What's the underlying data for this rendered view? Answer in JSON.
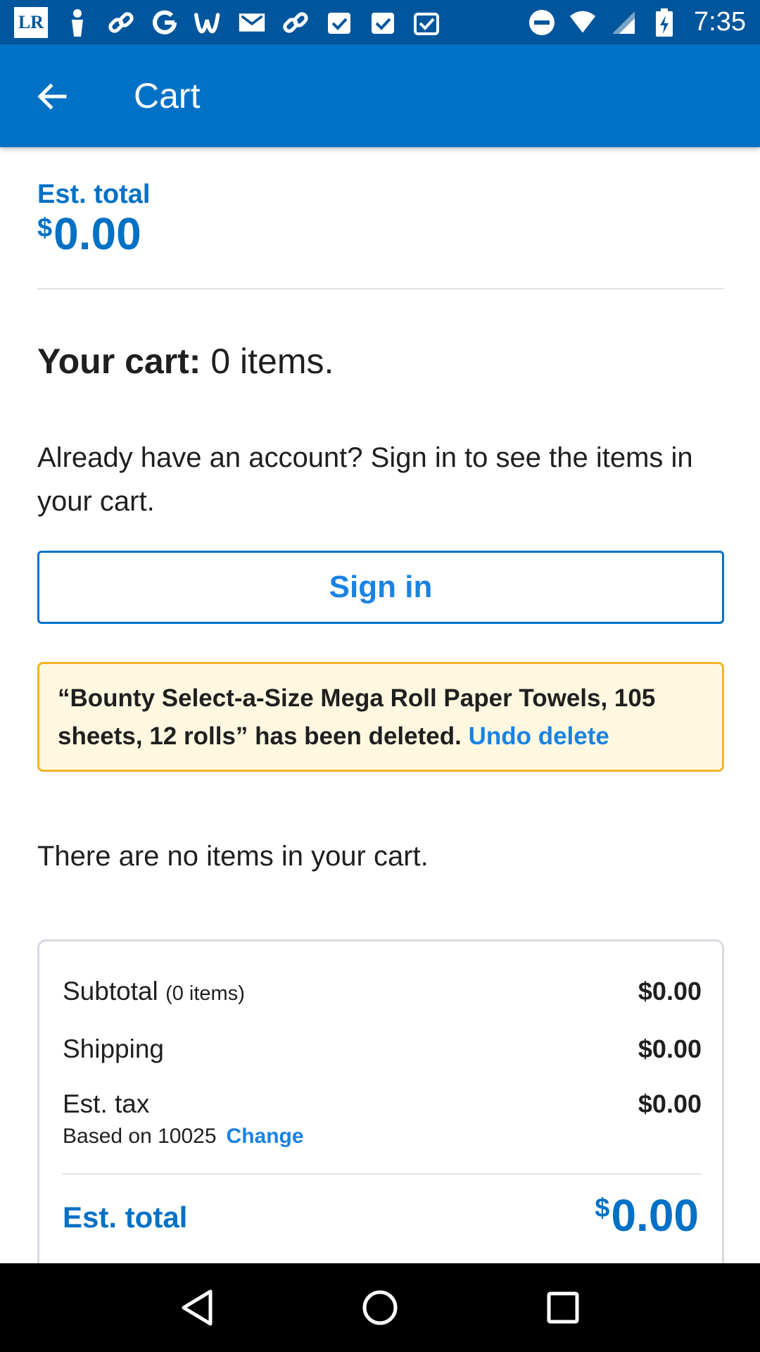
{
  "status_bar": {
    "time": "7:35",
    "left_badge": "LR",
    "icons": [
      "lr-app-icon",
      "person-icon",
      "link-icon",
      "google-icon",
      "w-icon",
      "gmail-icon",
      "link-icon",
      "clipboard-check-icon",
      "clipboard-check-icon",
      "clipboard-check-icon"
    ],
    "right_icons": [
      "do-not-disturb-icon",
      "wifi-icon",
      "signal-icon",
      "battery-charging-icon"
    ]
  },
  "app_bar": {
    "title": "Cart",
    "back_icon": "arrow-back-icon",
    "color": "#0071c5"
  },
  "estimate_top": {
    "label": "Est. total",
    "currency": "$",
    "amount": "0.00"
  },
  "cart": {
    "heading_bold": "Your cart:",
    "heading_rest": " 0 items.",
    "signin_prompt": "Already have an account? Sign in to see the items in your cart.",
    "signin_button": "Sign in",
    "empty_message": "There are no items in your cart."
  },
  "alert": {
    "message": "“Bounty Select-a-Size Mega Roll Paper Towels, 105 sheets, 12 rolls” has been deleted.",
    "undo_label": "Undo delete",
    "background": "#fff8e1",
    "border": "#f2b42a"
  },
  "summary": {
    "subtotal_label": "Subtotal",
    "subtotal_items": "(0 items)",
    "subtotal_value": "$0.00",
    "shipping_label": "Shipping",
    "shipping_value": "$0.00",
    "tax_label": "Est. tax",
    "tax_value": "$0.00",
    "tax_basis": "Based on 10025",
    "change_label": "Change",
    "total_label": "Est. total",
    "total_currency": "$",
    "total_amount": "0.00"
  },
  "nav_bar": {
    "buttons": [
      "back-triangle-icon",
      "home-circle-icon",
      "recents-square-icon"
    ]
  }
}
